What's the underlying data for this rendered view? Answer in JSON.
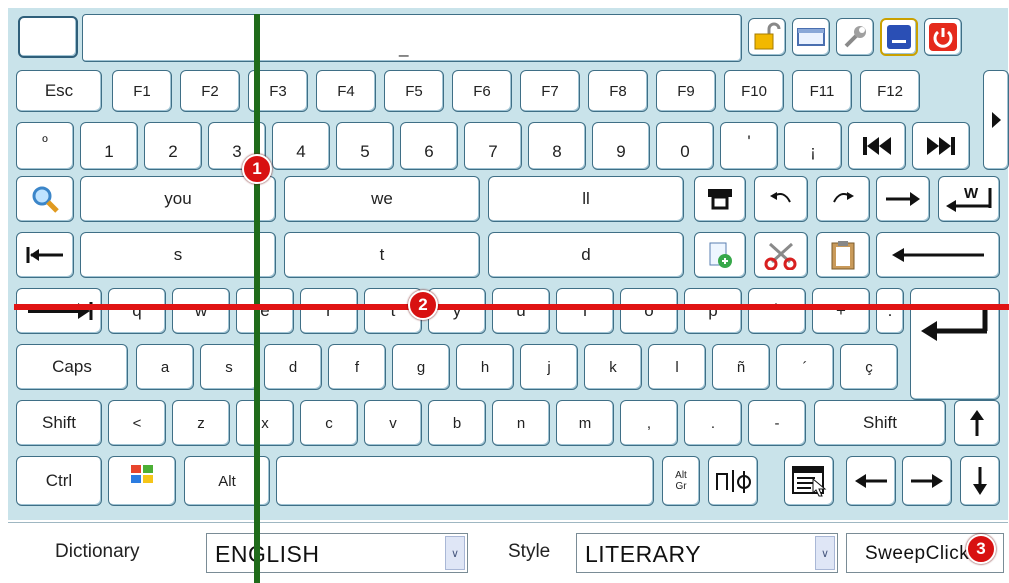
{
  "colors": {
    "keyboard_bg": "#c9e3ea",
    "key_border": "#3f6f86",
    "scan_vertical": "#1f6b1a",
    "scan_horizontal": "#e01414",
    "marker": "#d81111"
  },
  "top": {
    "text_field": "_"
  },
  "fkeys": [
    "Esc",
    "F1",
    "F2",
    "F3",
    "F4",
    "F5",
    "F6",
    "F7",
    "F8",
    "F9",
    "F10",
    "F11",
    "F12"
  ],
  "num_row": [
    "º",
    "1",
    "2",
    "3",
    "4",
    "5",
    "6",
    "7",
    "8",
    "9",
    "0",
    "'",
    "¡"
  ],
  "word_row1": [
    "you",
    "we",
    "ll"
  ],
  "word_row2": [
    "s",
    "t",
    "d"
  ],
  "q_row": [
    "q",
    "w",
    "e",
    "r",
    "t",
    "y",
    "u",
    "i",
    "o",
    "p",
    "`",
    "+",
    "."
  ],
  "caps_label": "Caps",
  "a_row": [
    "a",
    "s",
    "d",
    "f",
    "g",
    "h",
    "j",
    "k",
    "l",
    "ñ",
    "´",
    "ç"
  ],
  "shift_left": "Shift",
  "z_row": [
    "<",
    "z",
    "x",
    "c",
    "v",
    "b",
    "n",
    "m",
    ",",
    ".",
    "-"
  ],
  "shift_right": "Shift",
  "ctrl_label": "Ctrl",
  "alt_label": "Alt",
  "altgr_label": {
    "line1": "Alt",
    "line2": "Gr"
  },
  "bottom": {
    "dictionary_label": "Dictionary",
    "dictionary_value": "ENGLISH",
    "style_label": "Style",
    "style_value": "LITERARY",
    "sweep_button": "SweepClick"
  },
  "markers": [
    "1",
    "2",
    "3"
  ]
}
